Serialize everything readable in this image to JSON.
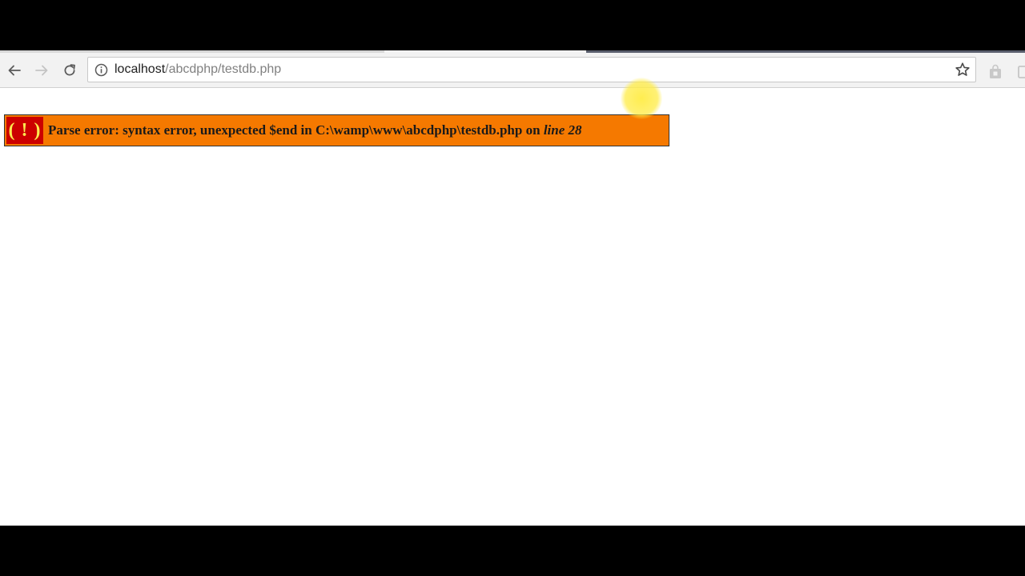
{
  "browser": {
    "url_host": "localhost",
    "url_path": "/abcdphp/testdb.php",
    "icons": {
      "back": "arrow-left-icon",
      "forward": "arrow-right-icon",
      "reload": "reload-icon",
      "site_info": "info-icon",
      "bookmark": "star-icon",
      "extension_1": "bag-icon",
      "extension_2": "extension-icon"
    }
  },
  "page": {
    "error": {
      "badge": "( ! )",
      "message": "Parse error: syntax error, unexpected $end in C:\\wamp\\www\\abcdphp\\testdb.php on ",
      "line_label": "line 28",
      "background_color": "#f57900",
      "badge_color": "#cc0000",
      "badge_text_color": "#fce94f"
    }
  }
}
